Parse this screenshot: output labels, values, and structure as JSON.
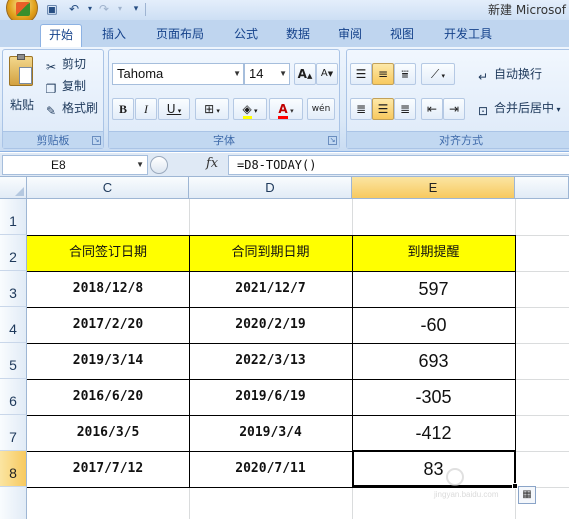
{
  "window": {
    "title": "新建 Microsof"
  },
  "quick_access": {
    "save_icon": "save-icon",
    "undo_icon": "undo-icon",
    "redo_icon": "redo-icon",
    "customize_icon": "customize-qat-icon"
  },
  "ribbon_tabs": [
    {
      "label": "开始",
      "active": true
    },
    {
      "label": "插入"
    },
    {
      "label": "页面布局"
    },
    {
      "label": "公式"
    },
    {
      "label": "数据"
    },
    {
      "label": "审阅"
    },
    {
      "label": "视图"
    },
    {
      "label": "开发工具"
    }
  ],
  "clipboard": {
    "paste_label": "粘贴",
    "cut_label": "剪切",
    "copy_label": "复制",
    "format_painter_label": "格式刷",
    "group_label": "剪贴板"
  },
  "font": {
    "font_name": "Tahoma",
    "font_size": "14",
    "bold": "B",
    "italic": "I",
    "underline": "U",
    "grow": "A",
    "shrink": "A",
    "font_color_glyph": "A",
    "phonetic": "wén",
    "group_label": "字体"
  },
  "alignment": {
    "wrap_text_label": "自动换行",
    "merge_center_label": "合并后居中",
    "group_label": "对齐方式"
  },
  "formula_bar": {
    "name_box": "E8",
    "fx_label": "fx",
    "formula": "=D8-TODAY()"
  },
  "columns": [
    {
      "label": "C",
      "selected": false
    },
    {
      "label": "D",
      "selected": false
    },
    {
      "label": "E",
      "selected": true
    }
  ],
  "rows": [
    {
      "label": "1",
      "selected": false
    },
    {
      "label": "2",
      "selected": false
    },
    {
      "label": "3",
      "selected": false
    },
    {
      "label": "4",
      "selected": false
    },
    {
      "label": "5",
      "selected": false
    },
    {
      "label": "6",
      "selected": false
    },
    {
      "label": "7",
      "selected": false
    },
    {
      "label": "8",
      "selected": true
    }
  ],
  "table": {
    "header_fill": "#ffff00",
    "headers": [
      "合同签订日期",
      "合同到期日期",
      "到期提醒"
    ],
    "rows": [
      [
        "2018/12/8",
        "2021/12/7",
        "597"
      ],
      [
        "2017/2/20",
        "2020/2/19",
        "-60"
      ],
      [
        "2019/3/14",
        "2022/3/13",
        "693"
      ],
      [
        "2016/6/20",
        "2019/6/19",
        "-305"
      ],
      [
        "2016/3/5",
        "2019/3/4",
        "-412"
      ],
      [
        "2017/7/12",
        "2020/7/11",
        "83"
      ]
    ]
  },
  "active_cell": "E8"
}
